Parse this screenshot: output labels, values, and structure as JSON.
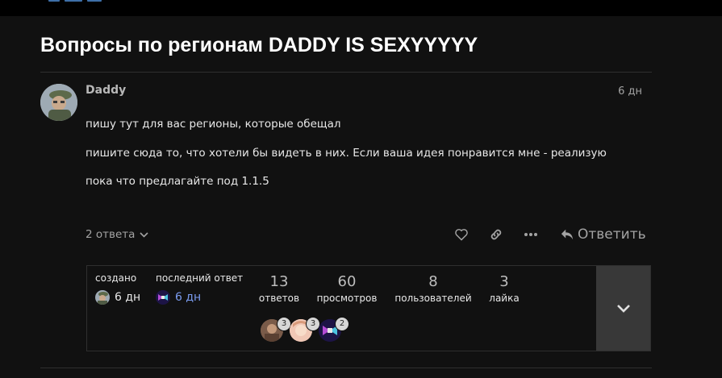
{
  "topic": {
    "title": "Вопросы по регионам DADDY IS SEXYYYYY"
  },
  "post": {
    "username": "Daddy",
    "date": "6 дн",
    "paragraphs": [
      "пишу тут для вас регионы, которые обещал",
      "пишите сюда то, что хотели бы видеть в них. Если ваша идея понравится мне - реализую",
      "пока что предлагайте под 1.1.5"
    ],
    "replies_toggle": "2 ответа",
    "reply_label": "Ответить",
    "icons": [
      "heart-icon",
      "link-icon",
      "more-icon",
      "reply-icon",
      "chevron-down-icon"
    ]
  },
  "summary": {
    "created_label": "создано",
    "created_value": "6 дн",
    "last_reply_label": "последний ответ",
    "last_reply_value": "6 дн",
    "stats": [
      {
        "num": "13",
        "label": "ответов"
      },
      {
        "num": "60",
        "label": "просмотров"
      },
      {
        "num": "8",
        "label": "пользователей"
      },
      {
        "num": "3",
        "label": "лайка"
      }
    ],
    "participants": [
      {
        "count": "3"
      },
      {
        "count": "3"
      },
      {
        "count": "2"
      }
    ]
  },
  "colors": {
    "background": "#111111",
    "title": "#ffffff",
    "muted": "#a3a3a3",
    "link_blue": "#7b9cf0",
    "expand_bg": "#383838"
  }
}
